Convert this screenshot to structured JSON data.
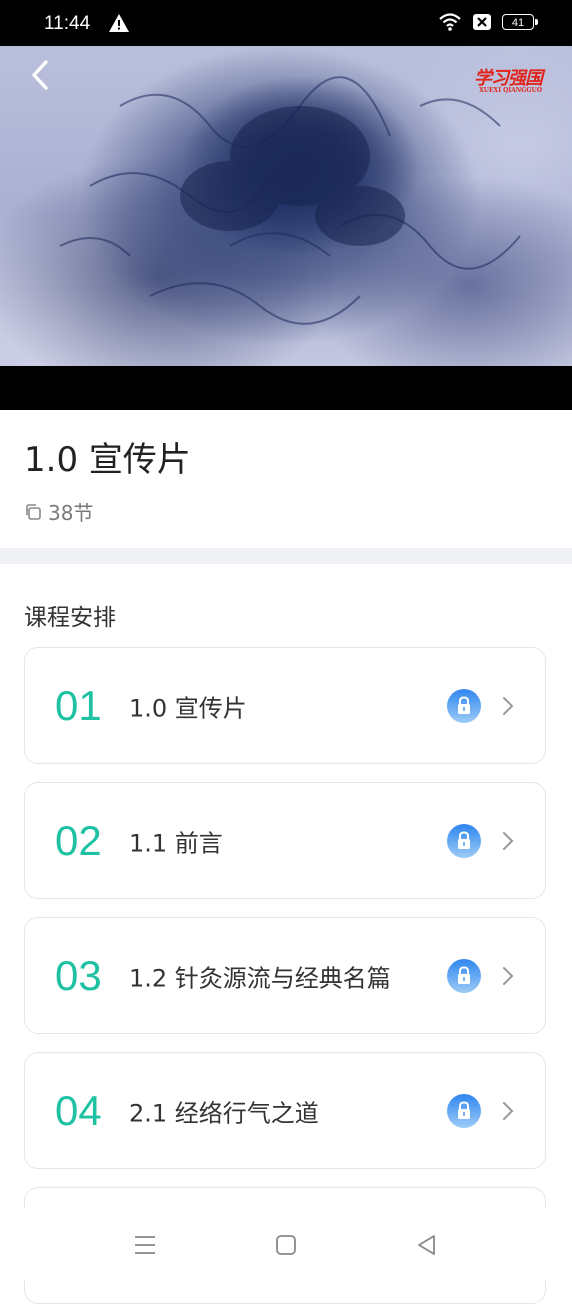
{
  "status_bar": {
    "time": "11:44",
    "battery": "41",
    "icons": [
      "warning-icon",
      "wifi-icon",
      "sim-x-icon",
      "battery-icon"
    ]
  },
  "video": {
    "logo_text": "学习强国",
    "logo_subtext": "XUEXI QIANGGUO"
  },
  "course": {
    "title": "1.0 宣传片",
    "section_count": "38节"
  },
  "schedule": {
    "heading": "课程安排",
    "lessons": [
      {
        "number": "01",
        "title": "1.0 宣传片"
      },
      {
        "number": "02",
        "title": "1.1 前言"
      },
      {
        "number": "03",
        "title": "1.2 针灸源流与经典名篇"
      },
      {
        "number": "04",
        "title": "2.1 经络行气之道"
      }
    ]
  },
  "colors": {
    "accent": "#1fc1a3",
    "lock_blue": "#3a8ff0",
    "divider": "#f0f1f5"
  }
}
